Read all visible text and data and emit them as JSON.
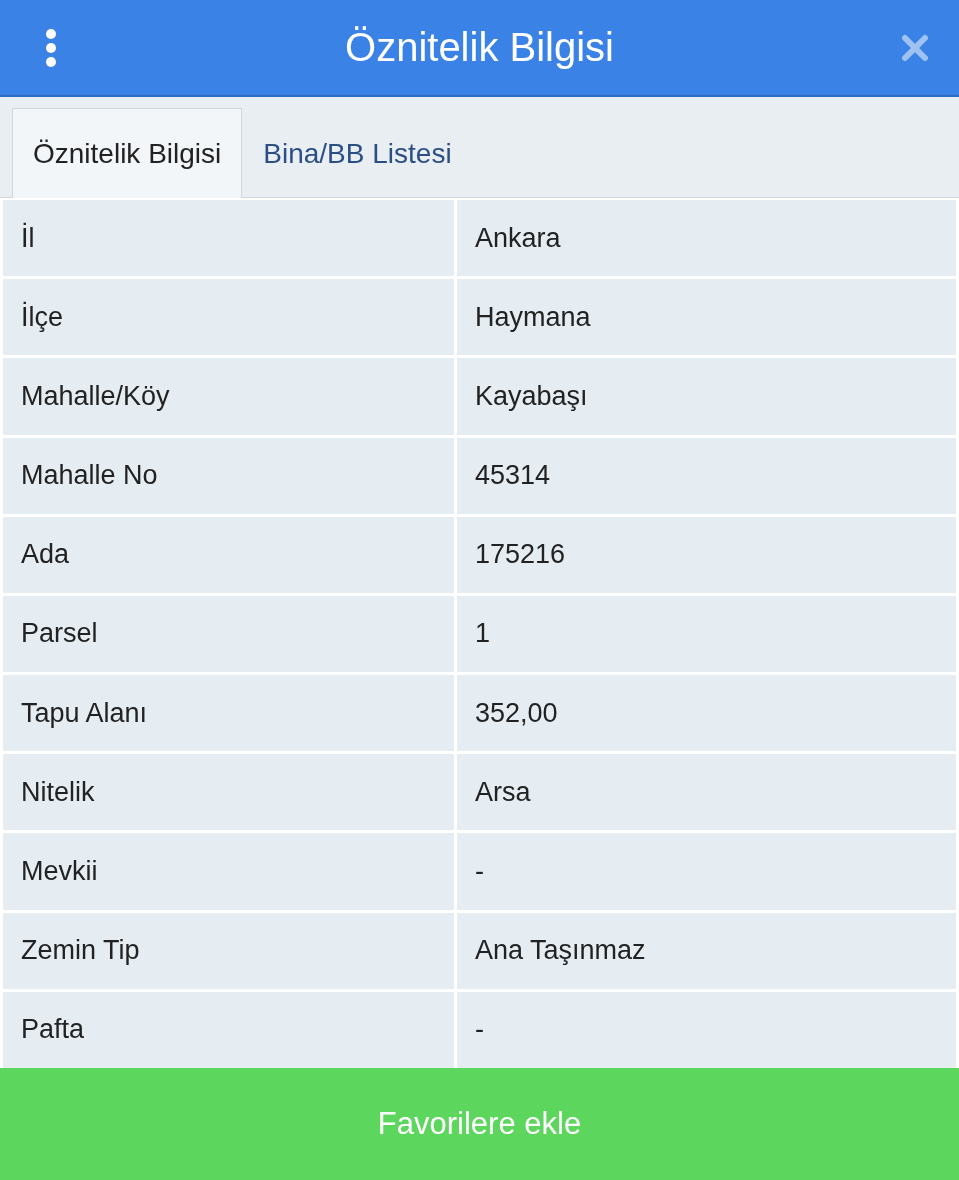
{
  "header": {
    "title": "Öznitelik Bilgisi"
  },
  "tabs": [
    {
      "label": "Öznitelik Bilgisi",
      "selected": true
    },
    {
      "label": "Bina/BB Listesi",
      "selected": false
    }
  ],
  "table": {
    "rows": [
      {
        "label": "İl",
        "value": "Ankara"
      },
      {
        "label": "İlçe",
        "value": "Haymana"
      },
      {
        "label": "Mahalle/Köy",
        "value": "Kayabaşı"
      },
      {
        "label": "Mahalle No",
        "value": "45314"
      },
      {
        "label": "Ada",
        "value": "175216"
      },
      {
        "label": "Parsel",
        "value": "1"
      },
      {
        "label": "Tapu Alanı",
        "value": "352,00"
      },
      {
        "label": "Nitelik",
        "value": "Arsa"
      },
      {
        "label": "Mevkii",
        "value": "-"
      },
      {
        "label": "Zemin Tip",
        "value": "Ana Taşınmaz"
      },
      {
        "label": "Pafta",
        "value": "-"
      }
    ]
  },
  "footer_button": "Favorilere ekle"
}
